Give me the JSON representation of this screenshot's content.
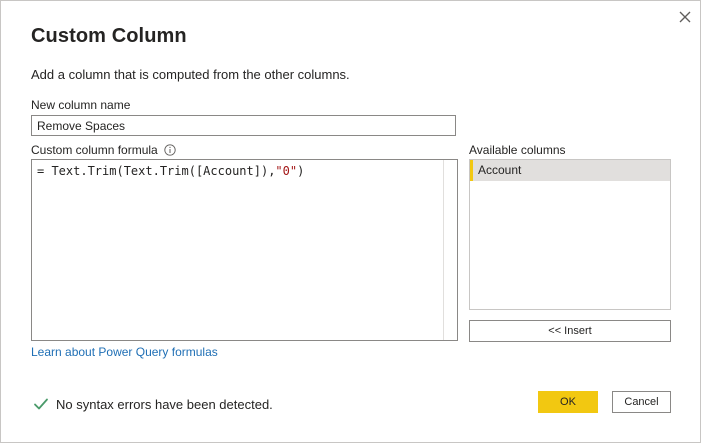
{
  "dialog": {
    "title": "Custom Column",
    "subtitle": "Add a column that is computed from the other columns.",
    "close_icon": "close-icon"
  },
  "new_column": {
    "label": "New column name",
    "value": "Remove Spaces"
  },
  "formula": {
    "label": "Custom column formula",
    "info_icon": "info-icon",
    "prefix": "= Text.Trim(Text.Trim([Account]),",
    "string_literal": "\"0\"",
    "suffix": ")",
    "string_color": "#a31515"
  },
  "available_columns": {
    "label": "Available columns",
    "items": [
      {
        "label": "Account",
        "selected": true
      }
    ],
    "insert_label": "<< Insert",
    "selection_accent": "#f2c811"
  },
  "learn_link": "Learn about Power Query formulas",
  "status": {
    "icon": "check-icon",
    "text": "No syntax errors have been detected.",
    "icon_color": "#4a9a6a"
  },
  "buttons": {
    "ok": "OK",
    "cancel": "Cancel",
    "ok_color": "#f2c811"
  }
}
